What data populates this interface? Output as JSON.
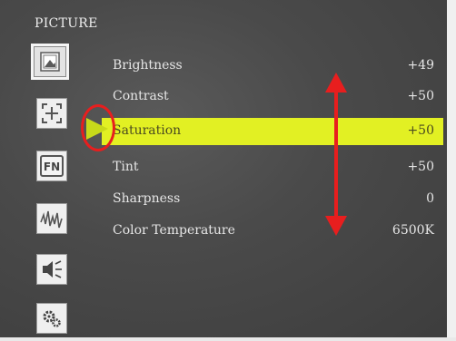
{
  "menu": {
    "title": "PICTURE"
  },
  "sidebar": {
    "items": [
      {
        "icon": "picture-icon",
        "active": true
      },
      {
        "icon": "aspect-ratio-icon",
        "active": false
      },
      {
        "icon": "function-key-icon",
        "label": "FN",
        "active": false
      },
      {
        "icon": "waveform-icon",
        "active": false
      },
      {
        "icon": "speaker-icon",
        "active": false
      },
      {
        "icon": "settings-gear-icon",
        "active": false
      }
    ]
  },
  "picture_settings": [
    {
      "label": "Brightness",
      "value": "+49",
      "selected": false
    },
    {
      "label": "Contrast",
      "value": "+50",
      "selected": false
    },
    {
      "label": "Saturation",
      "value": "+50",
      "selected": true
    },
    {
      "label": "Tint",
      "value": "+50",
      "selected": false
    },
    {
      "label": "Sharpness",
      "value": "0",
      "selected": false
    },
    {
      "label": "Color Temperature",
      "value": "6500K",
      "selected": false
    }
  ],
  "colors": {
    "highlight": "#e2f023",
    "annotation": "#e81e1e",
    "background": "#4a4a4a"
  }
}
